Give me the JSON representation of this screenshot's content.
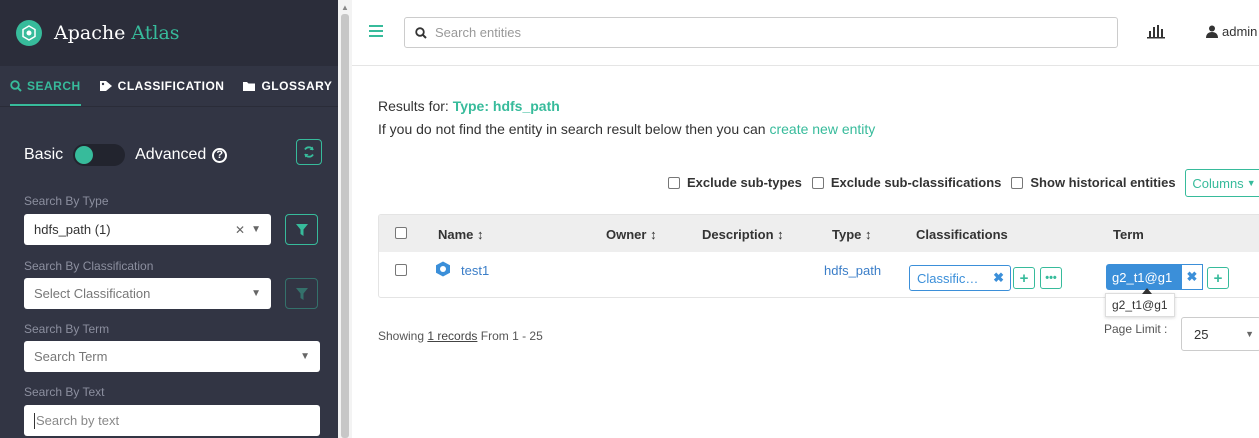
{
  "brand": {
    "name_part1": "Apache",
    "name_part2": "Atlas"
  },
  "sidebar": {
    "tabs": [
      {
        "label": "SEARCH",
        "icon": "search-icon",
        "active": true
      },
      {
        "label": "CLASSIFICATION",
        "icon": "tag-icon",
        "active": false
      },
      {
        "label": "GLOSSARY",
        "icon": "folder-icon",
        "active": false
      }
    ],
    "toggle": {
      "left_label": "Basic",
      "right_label": "Advanced",
      "state": "basic"
    },
    "search_by_type": {
      "label": "Search By Type",
      "value": "hdfs_path (1)"
    },
    "search_by_classification": {
      "label": "Search By Classification",
      "placeholder": "Select Classification"
    },
    "search_by_term": {
      "label": "Search By Term",
      "placeholder": "Search Term"
    },
    "search_by_text": {
      "label": "Search By Text",
      "placeholder": "Search by text"
    }
  },
  "header": {
    "search_placeholder": "Search entities",
    "user": "admin"
  },
  "results": {
    "results_for_label": "Results for:",
    "results_for_value": "Type: hdfs_path",
    "hint_text": "If you do not find the entity in search result below then you can",
    "hint_link": "create new entity",
    "filters": {
      "exclude_subtypes": "Exclude sub-types",
      "exclude_subclassifications": "Exclude sub-classifications",
      "show_historical": "Show historical entities"
    },
    "columns_button": "Columns",
    "table": {
      "headers": {
        "name": "Name ↕",
        "owner": "Owner ↕",
        "description": "Description ↕",
        "type": "Type ↕",
        "classifications": "Classifications",
        "term": "Term"
      },
      "rows": [
        {
          "name": "test1",
          "owner": "",
          "description": "",
          "type": "hdfs_path",
          "classification": "Classific…",
          "term": "g2_t1@g1"
        }
      ]
    },
    "tooltip": "g2_t1@g1",
    "showing_prefix": "Showing",
    "showing_records": "1 records",
    "showing_suffix": "From 1 - 25",
    "page_limit_label": "Page Limit :",
    "page_limit_value": "25"
  },
  "colors": {
    "accent": "#37bb9b",
    "sidebar_bg": "#323544",
    "link_blue": "#3b8fd9"
  }
}
